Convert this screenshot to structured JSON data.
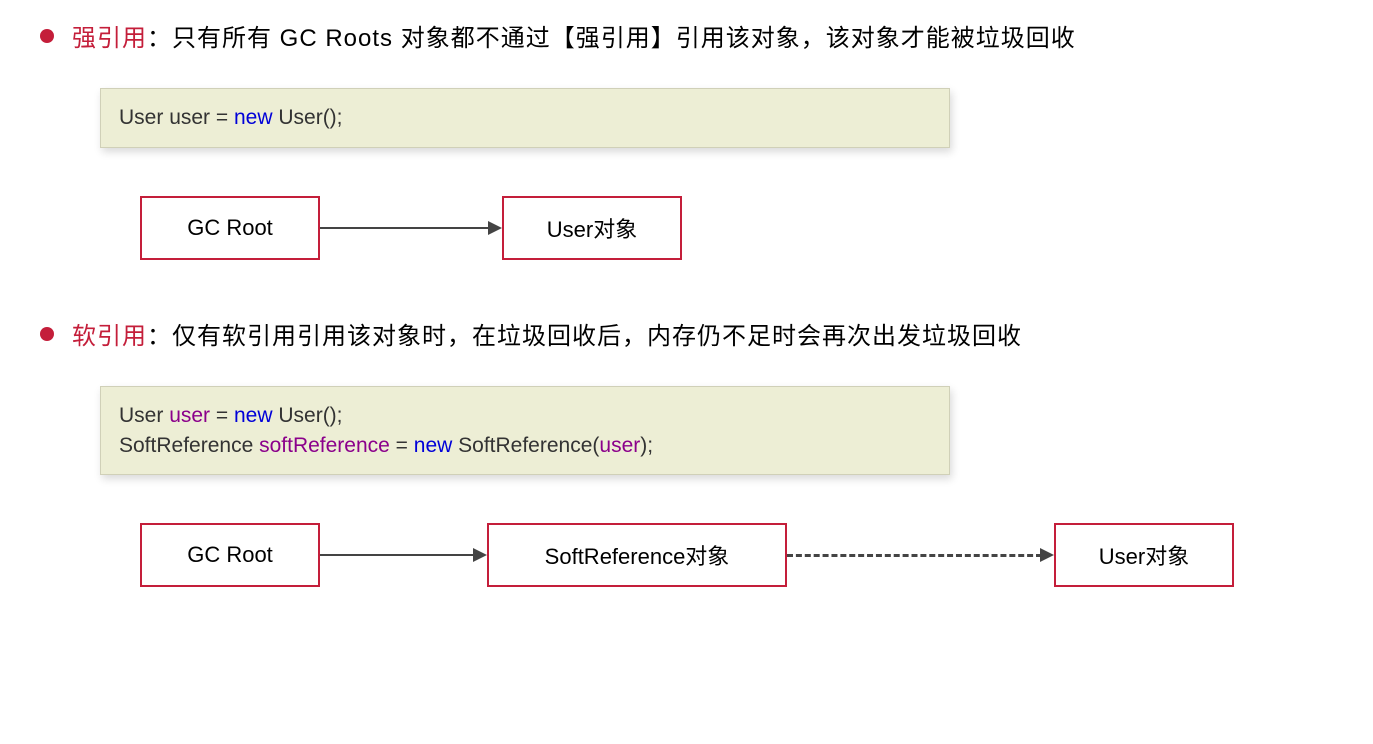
{
  "section1": {
    "title": "强引用",
    "colon": "：",
    "description": "只有所有 GC Roots 对象都不通过【强引用】引用该对象，该对象才能被垃圾回收",
    "code": {
      "parts": [
        {
          "text": "User ",
          "class": "code-black"
        },
        {
          "text": "user",
          "class": "code-black"
        },
        {
          "text": " = ",
          "class": "code-black"
        },
        {
          "text": "new",
          "class": "kw-blue"
        },
        {
          "text": " User();",
          "class": "code-black"
        }
      ]
    },
    "diagram": {
      "box1": "GC Root",
      "box2": "User对象"
    }
  },
  "section2": {
    "title": "软引用",
    "colon": "：",
    "description": "仅有软引用引用该对象时，在垃圾回收后，内存仍不足时会再次出发垃圾回收",
    "code": {
      "line1": [
        {
          "text": "User ",
          "class": "code-black"
        },
        {
          "text": "user",
          "class": "kw-purple"
        },
        {
          "text": " = ",
          "class": "code-black"
        },
        {
          "text": "new",
          "class": "kw-blue"
        },
        {
          "text": " User();",
          "class": "code-black"
        }
      ],
      "line2": [
        {
          "text": "SoftReference ",
          "class": "code-black"
        },
        {
          "text": "softReference",
          "class": "kw-purple"
        },
        {
          "text": " = ",
          "class": "code-black"
        },
        {
          "text": "new",
          "class": "kw-blue"
        },
        {
          "text": " SoftReference(",
          "class": "code-black"
        },
        {
          "text": "user",
          "class": "kw-purple"
        },
        {
          "text": ");",
          "class": "code-black"
        }
      ]
    },
    "diagram": {
      "box1": "GC Root",
      "box2": "SoftReference对象",
      "box3": "User对象"
    }
  }
}
